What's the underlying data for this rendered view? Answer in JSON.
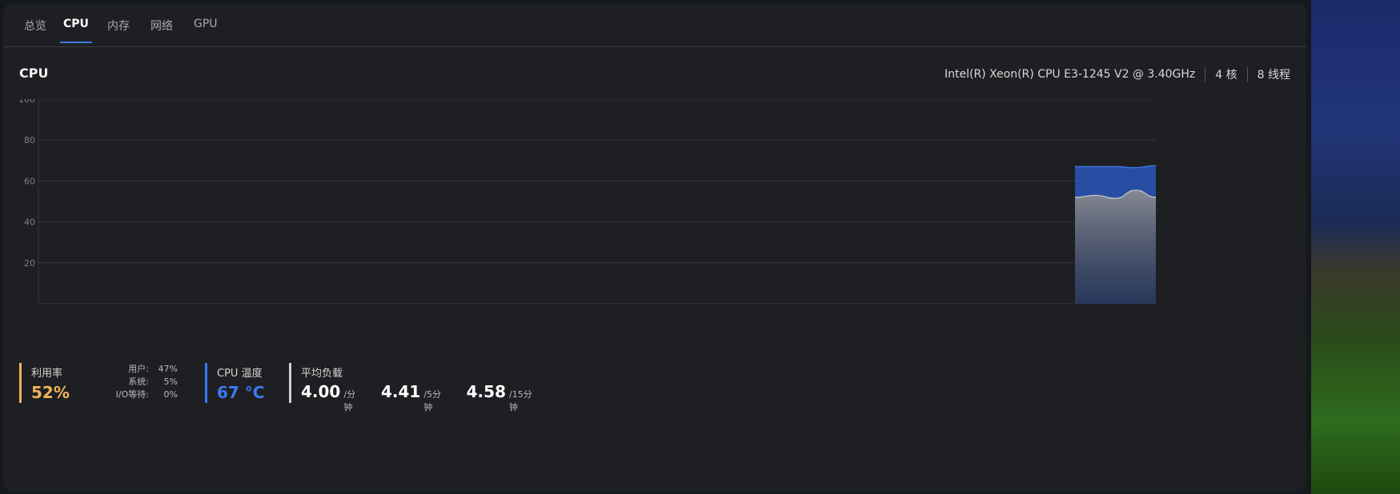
{
  "tabs": [
    {
      "label": "总览"
    },
    {
      "label": "CPU"
    },
    {
      "label": "内存"
    },
    {
      "label": "网络"
    },
    {
      "label": "GPU"
    }
  ],
  "active_tab": "CPU",
  "section_title": "CPU",
  "cpu_info": {
    "model": "Intel(R) Xeon(R) CPU E3-1245 V2 @ 3.40GHz",
    "cores": "4 核",
    "threads": "8 线程"
  },
  "chart_data": {
    "type": "area",
    "title": "",
    "ylim": [
      0,
      100
    ],
    "y_ticks": [
      "100",
      "80",
      "60",
      "40",
      "20"
    ],
    "series": [
      {
        "values": [
          67,
          67,
          67,
          66.5,
          67.5
        ],
        "color": "#2b56b8"
      },
      {
        "values": [
          52,
          53,
          51.5,
          55.5,
          52
        ],
        "color": "#8a8d92"
      }
    ],
    "grid": true
  },
  "stats": {
    "utilization": {
      "label": "利用率",
      "value": "52%",
      "color": "#f0b35a",
      "user_label": "用户:",
      "user_value": "47%",
      "system_label": "系统:",
      "system_value": "5%",
      "io_label": "I/O等待:",
      "io_value": "0%"
    },
    "temperature": {
      "label": "CPU 温度",
      "value": "67 °C",
      "color": "#3a7bf0"
    },
    "load": {
      "label": "平均负载",
      "load1": "4.00",
      "load1_unit": "/分钟",
      "load5": "4.41",
      "load5_unit": "/5分钟",
      "load15": "4.58",
      "load15_unit": "/15分钟",
      "color": "#d0d0d0"
    }
  }
}
